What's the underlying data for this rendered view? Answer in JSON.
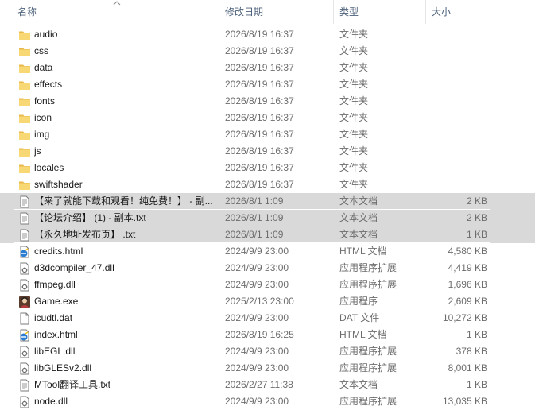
{
  "columns": {
    "name": "名称",
    "date": "修改日期",
    "type": "类型",
    "size": "大小"
  },
  "rows": [
    {
      "icon": "folder-icon",
      "name": "audio",
      "date": "2026/8/19 16:37",
      "type": "文件夹",
      "size": "",
      "selected": false
    },
    {
      "icon": "folder-icon",
      "name": "css",
      "date": "2026/8/19 16:37",
      "type": "文件夹",
      "size": "",
      "selected": false
    },
    {
      "icon": "folder-icon",
      "name": "data",
      "date": "2026/8/19 16:37",
      "type": "文件夹",
      "size": "",
      "selected": false
    },
    {
      "icon": "folder-icon",
      "name": "effects",
      "date": "2026/8/19 16:37",
      "type": "文件夹",
      "size": "",
      "selected": false
    },
    {
      "icon": "folder-icon",
      "name": "fonts",
      "date": "2026/8/19 16:37",
      "type": "文件夹",
      "size": "",
      "selected": false
    },
    {
      "icon": "folder-icon",
      "name": "icon",
      "date": "2026/8/19 16:37",
      "type": "文件夹",
      "size": "",
      "selected": false
    },
    {
      "icon": "folder-icon",
      "name": "img",
      "date": "2026/8/19 16:37",
      "type": "文件夹",
      "size": "",
      "selected": false
    },
    {
      "icon": "folder-icon",
      "name": "js",
      "date": "2026/8/19 16:37",
      "type": "文件夹",
      "size": "",
      "selected": false
    },
    {
      "icon": "folder-icon",
      "name": "locales",
      "date": "2026/8/19 16:37",
      "type": "文件夹",
      "size": "",
      "selected": false
    },
    {
      "icon": "folder-icon",
      "name": "swiftshader",
      "date": "2026/8/19 16:37",
      "type": "文件夹",
      "size": "",
      "selected": false
    },
    {
      "icon": "text-file-icon",
      "name": "【来了就能下载和观看！纯免费！】 - 副...",
      "date": "2026/8/1 1:09",
      "type": "文本文档",
      "size": "2 KB",
      "selected": true
    },
    {
      "icon": "text-file-icon",
      "name": "【论坛介绍】 (1) - 副本.txt",
      "date": "2026/8/1 1:09",
      "type": "文本文档",
      "size": "2 KB",
      "selected": true
    },
    {
      "icon": "text-file-icon",
      "name": "【永久地址发布页】 .txt",
      "date": "2026/8/1 1:09",
      "type": "文本文档",
      "size": "1 KB",
      "selected": true
    },
    {
      "icon": "html-file-icon",
      "name": "credits.html",
      "date": "2024/9/9 23:00",
      "type": "HTML 文档",
      "size": "4,580 KB",
      "selected": false
    },
    {
      "icon": "dll-file-icon",
      "name": "d3dcompiler_47.dll",
      "date": "2024/9/9 23:00",
      "type": "应用程序扩展",
      "size": "4,419 KB",
      "selected": false
    },
    {
      "icon": "dll-file-icon",
      "name": "ffmpeg.dll",
      "date": "2024/9/9 23:00",
      "type": "应用程序扩展",
      "size": "1,696 KB",
      "selected": false
    },
    {
      "icon": "game-exe-icon",
      "name": "Game.exe",
      "date": "2025/2/13 23:00",
      "type": "应用程序",
      "size": "2,609 KB",
      "selected": false
    },
    {
      "icon": "dat-file-icon",
      "name": "icudtl.dat",
      "date": "2024/9/9 23:00",
      "type": "DAT 文件",
      "size": "10,272 KB",
      "selected": false
    },
    {
      "icon": "html-file-icon",
      "name": "index.html",
      "date": "2026/8/19 16:25",
      "type": "HTML 文档",
      "size": "1 KB",
      "selected": false
    },
    {
      "icon": "dll-file-icon",
      "name": "libEGL.dll",
      "date": "2024/9/9 23:00",
      "type": "应用程序扩展",
      "size": "378 KB",
      "selected": false
    },
    {
      "icon": "dll-file-icon",
      "name": "libGLESv2.dll",
      "date": "2024/9/9 23:00",
      "type": "应用程序扩展",
      "size": "8,001 KB",
      "selected": false
    },
    {
      "icon": "text-file-icon",
      "name": "MTool翻译工具.txt",
      "date": "2026/2/27 11:38",
      "type": "文本文档",
      "size": "1 KB",
      "selected": false
    },
    {
      "icon": "dll-file-icon",
      "name": "node.dll",
      "date": "2024/9/9 23:00",
      "type": "应用程序扩展",
      "size": "13,035 KB",
      "selected": false
    }
  ]
}
